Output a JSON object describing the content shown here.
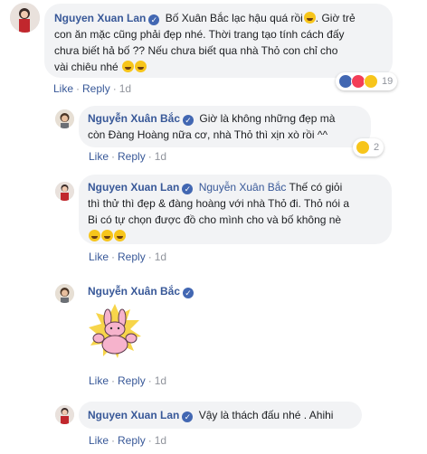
{
  "comments": [
    {
      "author": "Nguyen Xuan Lan",
      "text_a": "Bố Xuân Bắc lạc hậu quá rồi",
      "text_b": ". Giờ trẻ",
      "line2": "con ăn mặc cũng phải đẹp nhé. Thời trang tạo tính cách đấy",
      "line3": "chưa biết hả bố ?? Nếu chưa biết qua nhà Thỏ con chỉ cho",
      "line4": "vài chiêu nhé",
      "reaction_count": "19",
      "like": "Like",
      "reply": "Reply",
      "time": "1d"
    },
    {
      "author": "Nguyễn Xuân Bắc",
      "text_a": "Giờ là không những đẹp mà",
      "line2": "còn Đàng Hoàng nữa cơ, nhà Thỏ thì xịn xò rồi ^^",
      "reaction_count": "2",
      "like": "Like",
      "reply": "Reply",
      "time": "1d"
    },
    {
      "author": "Nguyen Xuan Lan",
      "mention": "Nguyễn Xuân Bắc",
      "text_a": "Thế có giỏi",
      "line2": "thì thử thì đẹp & đàng hoàng với nhà Thỏ đi. Thỏ nói a",
      "line3": "Bi có tự chọn được đồ cho mình cho và bố không nè",
      "like": "Like",
      "reply": "Reply",
      "time": "1d"
    },
    {
      "author": "Nguyễn Xuân Bắc",
      "like": "Like",
      "reply": "Reply",
      "time": "1d"
    },
    {
      "author": "Nguyen Xuan Lan",
      "text_a": "Vậy là thách đấu nhé . Ahihi",
      "like": "Like",
      "reply": "Reply",
      "time": "1d"
    }
  ],
  "icons": {
    "verified": "verified-badge-icon",
    "like_reaction": "like-reaction-icon",
    "love_reaction": "love-reaction-icon",
    "haha_reaction": "haha-reaction-icon",
    "laughing_emoji": "laughing-emoji",
    "sticker": "pink-bunny-muscle-sticker"
  },
  "colors": {
    "name": "#385898",
    "bubble": "#f2f3f5",
    "verified": "#4267b2",
    "meta": "#90949c",
    "like_reaction": "#4267b2",
    "love_reaction": "#f33e58",
    "haha_reaction": "#f7c51b",
    "sticker_pink": "#f6b3cc"
  }
}
